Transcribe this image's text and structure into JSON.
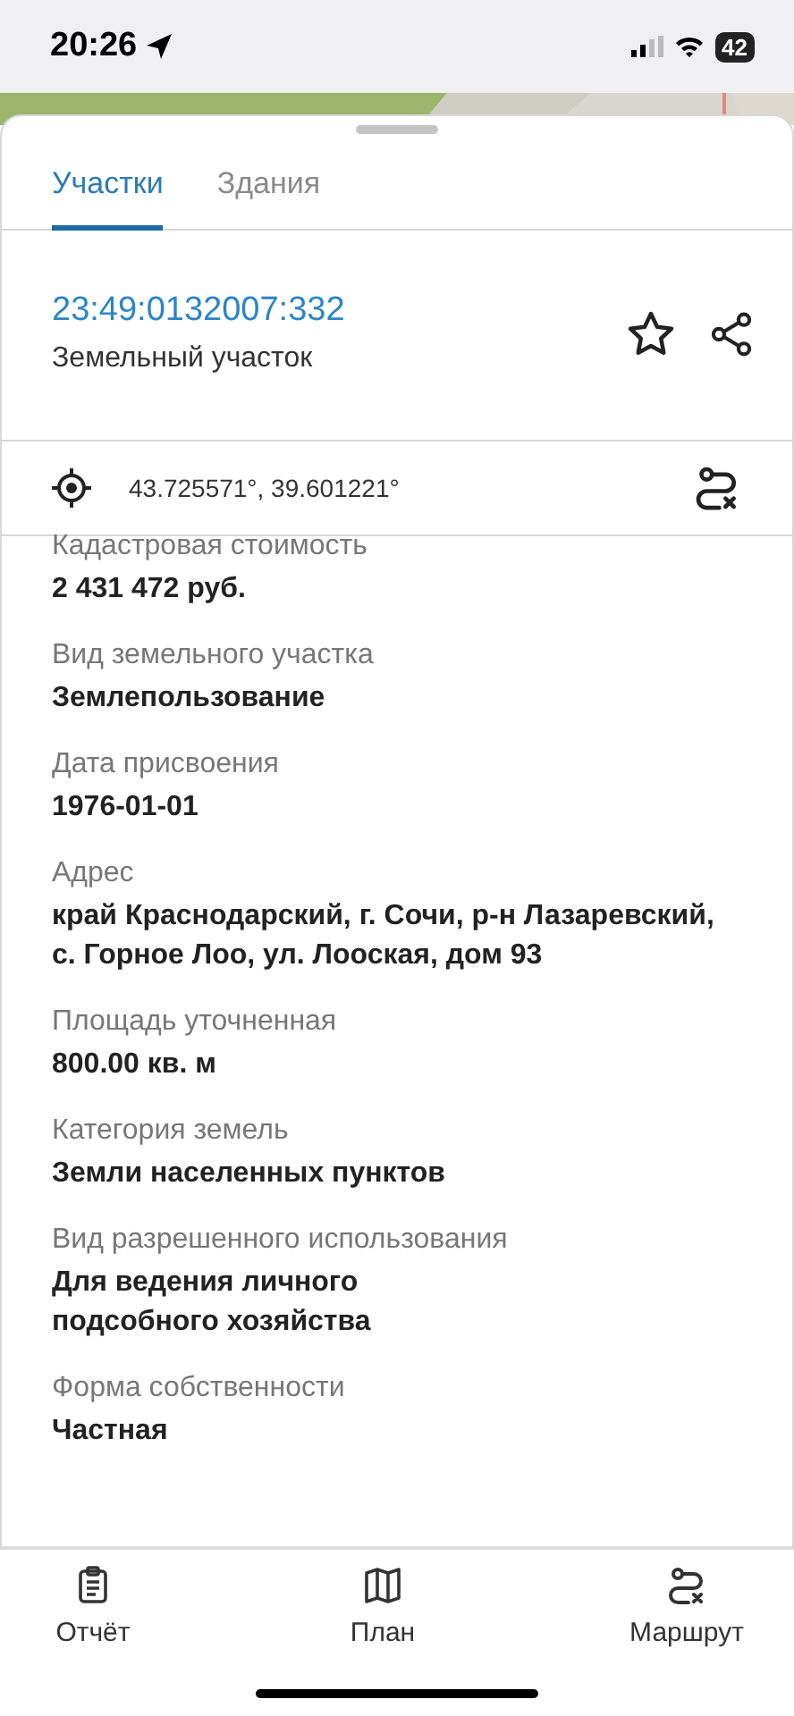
{
  "status_bar": {
    "time": "20:26",
    "battery": "42"
  },
  "tabs": [
    {
      "label": "Участки",
      "selected": true
    },
    {
      "label": "Здания",
      "selected": false
    }
  ],
  "parcel": {
    "number": "23:49:0132007:332",
    "type": "Земельный участок"
  },
  "coordinates": "43.725571°, 39.601221°",
  "fields": [
    {
      "label": "Кадастровая стоимость",
      "value": "2 431 472 руб."
    },
    {
      "label": "Вид земельного участка",
      "value": "Землепользование"
    },
    {
      "label": "Дата присвоения",
      "value": "1976-01-01"
    },
    {
      "label": "Адрес",
      "value": "край Краснодарский, г. Сочи, р-н Лазаревский, с. Горное Лоо, ул. Лооская, дом 93"
    },
    {
      "label": "Площадь уточненная",
      "value": "800.00 кв. м"
    },
    {
      "label": "Категория земель",
      "value": "Земли населенных пунктов"
    },
    {
      "label": "Вид разрешенного использования",
      "value": "Для ведения личного\nподсобного хозяйства"
    },
    {
      "label": "Форма собственности",
      "value": "Частная"
    }
  ],
  "bottom_nav": [
    {
      "kind": "report",
      "label": "Отчёт"
    },
    {
      "kind": "plan",
      "label": "План"
    },
    {
      "kind": "route",
      "label": "Маршрут"
    }
  ]
}
